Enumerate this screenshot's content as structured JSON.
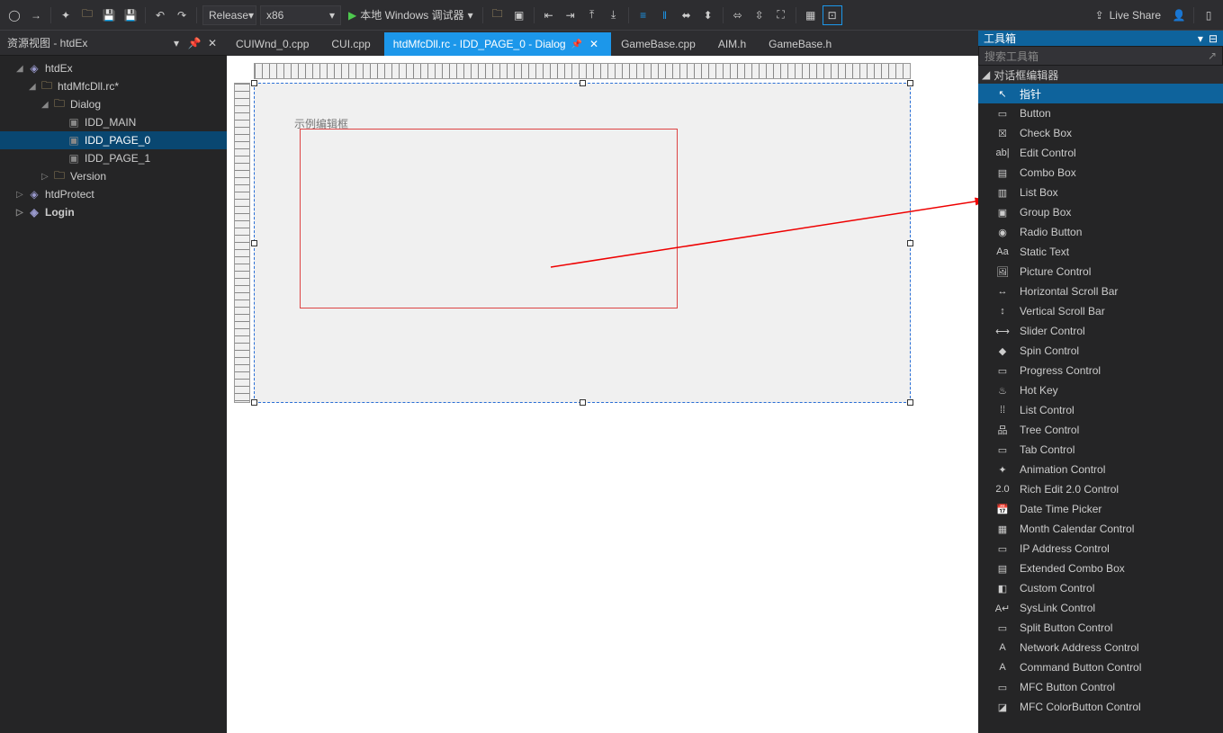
{
  "toolbar": {
    "release": "Release",
    "platform": "x86",
    "debugger": "本地 Windows 调试器",
    "live_share": "Live Share"
  },
  "left_pane": {
    "title": "资源视图 - htdEx",
    "tree": {
      "root": "htdEx",
      "proj": "htdMfcDll.rc*",
      "folder_dialog": "Dialog",
      "idd_main": "IDD_MAIN",
      "idd_page0": "IDD_PAGE_0",
      "idd_page1": "IDD_PAGE_1",
      "folder_version": "Version",
      "htdprotect": "htdProtect",
      "login": "Login"
    }
  },
  "tabs": [
    {
      "label": "CUIWnd_0.cpp",
      "active": false
    },
    {
      "label": "CUI.cpp",
      "active": false
    },
    {
      "label": "htdMfcDll.rc - IDD_PAGE_0 - Dialog",
      "active": true
    },
    {
      "label": "GameBase.cpp",
      "active": false
    },
    {
      "label": "AIM.h",
      "active": false
    },
    {
      "label": "GameBase.h",
      "active": false
    }
  ],
  "design": {
    "edit_label": "示例编辑框"
  },
  "toolbox": {
    "title": "工具箱",
    "search_placeholder": "搜索工具箱",
    "section": "对话框编辑器",
    "items": [
      {
        "icon": "↖",
        "label": "指针",
        "sel": true
      },
      {
        "icon": "▭",
        "label": "Button"
      },
      {
        "icon": "☒",
        "label": "Check Box"
      },
      {
        "icon": "ab|",
        "label": "Edit Control"
      },
      {
        "icon": "▤",
        "label": "Combo Box"
      },
      {
        "icon": "▥",
        "label": "List Box"
      },
      {
        "icon": "▣",
        "label": "Group Box"
      },
      {
        "icon": "◉",
        "label": "Radio Button"
      },
      {
        "icon": "Aa",
        "label": "Static Text"
      },
      {
        "icon": "🖼",
        "label": "Picture Control"
      },
      {
        "icon": "↔",
        "label": "Horizontal Scroll Bar"
      },
      {
        "icon": "↕",
        "label": "Vertical Scroll Bar"
      },
      {
        "icon": "⟷",
        "label": "Slider Control"
      },
      {
        "icon": "◆",
        "label": "Spin Control"
      },
      {
        "icon": "▭",
        "label": "Progress Control"
      },
      {
        "icon": "♨",
        "label": "Hot Key"
      },
      {
        "icon": "⁞⁞",
        "label": "List Control"
      },
      {
        "icon": "品",
        "label": "Tree Control"
      },
      {
        "icon": "▭",
        "label": "Tab Control"
      },
      {
        "icon": "✦",
        "label": "Animation Control"
      },
      {
        "icon": "2.0",
        "label": "Rich Edit 2.0 Control"
      },
      {
        "icon": "📅",
        "label": "Date Time Picker"
      },
      {
        "icon": "▦",
        "label": "Month Calendar Control"
      },
      {
        "icon": "▭",
        "label": "IP Address Control"
      },
      {
        "icon": "▤",
        "label": "Extended Combo Box"
      },
      {
        "icon": "◧",
        "label": "Custom Control"
      },
      {
        "icon": "A↵",
        "label": "SysLink Control"
      },
      {
        "icon": "▭",
        "label": "Split Button Control"
      },
      {
        "icon": "A",
        "label": "Network Address Control"
      },
      {
        "icon": "A",
        "label": "Command Button Control"
      },
      {
        "icon": "▭",
        "label": "MFC Button Control"
      },
      {
        "icon": "◪",
        "label": "MFC ColorButton Control"
      }
    ]
  }
}
